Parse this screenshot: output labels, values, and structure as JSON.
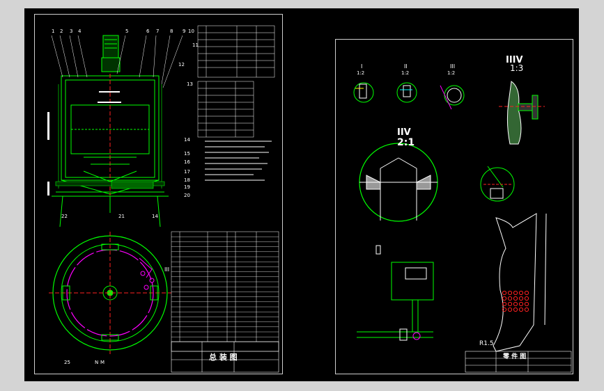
{
  "left_sheet": {
    "title_block": {
      "title": "总 装 图"
    },
    "section_label_main": "III",
    "part_numbers_top": [
      "1",
      "2",
      "3",
      "4",
      "5",
      "6",
      "7",
      "8",
      "9",
      "10",
      "11",
      "12",
      "13"
    ],
    "part_numbers_side": [
      "14",
      "15",
      "16",
      "17",
      "18",
      "19",
      "20"
    ],
    "part_numbers_bottom": [
      "22",
      "21",
      "14"
    ],
    "bottom_labels": [
      "25",
      "N",
      "M"
    ]
  },
  "right_sheet": {
    "detail_I": "I",
    "detail_II": "II",
    "detail_III": "III",
    "scale_12_a": "1:2",
    "scale_12_b": "1:2",
    "scale_12_c": "1:2",
    "detail_IIIV": "IIIV",
    "scale_13": "1:3",
    "detail_IIV": "IIV",
    "scale_21": "2:1",
    "dim_r5": "R1.5",
    "title_block": {
      "title": "零 件 图"
    }
  },
  "colors": {
    "background": "#000000",
    "outer": "#d4d4d4",
    "frame": "#cfcfcf",
    "geometry": "#00ff00",
    "highlight": "#ff00ff",
    "text": "#ffffff",
    "accent_red": "#ff2020",
    "accent_yellow": "#ffff00",
    "accent_cyan": "#00ffff"
  }
}
